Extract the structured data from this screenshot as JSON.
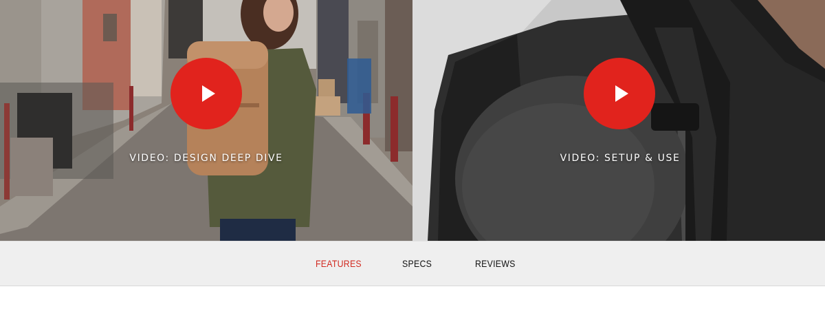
{
  "videos": [
    {
      "caption": "VIDEO: DESIGN DEEP DIVE",
      "play_icon": "play-icon"
    },
    {
      "caption": "VIDEO: SETUP & USE",
      "play_icon": "play-icon"
    }
  ],
  "tabs": [
    {
      "label": "FEATURES",
      "active": true
    },
    {
      "label": "SPECS",
      "active": false
    },
    {
      "label": "REVIEWS",
      "active": false
    }
  ],
  "colors": {
    "accent": "#e1231d",
    "active_tab": "#d12a20",
    "tab_bar": "#efefef"
  }
}
